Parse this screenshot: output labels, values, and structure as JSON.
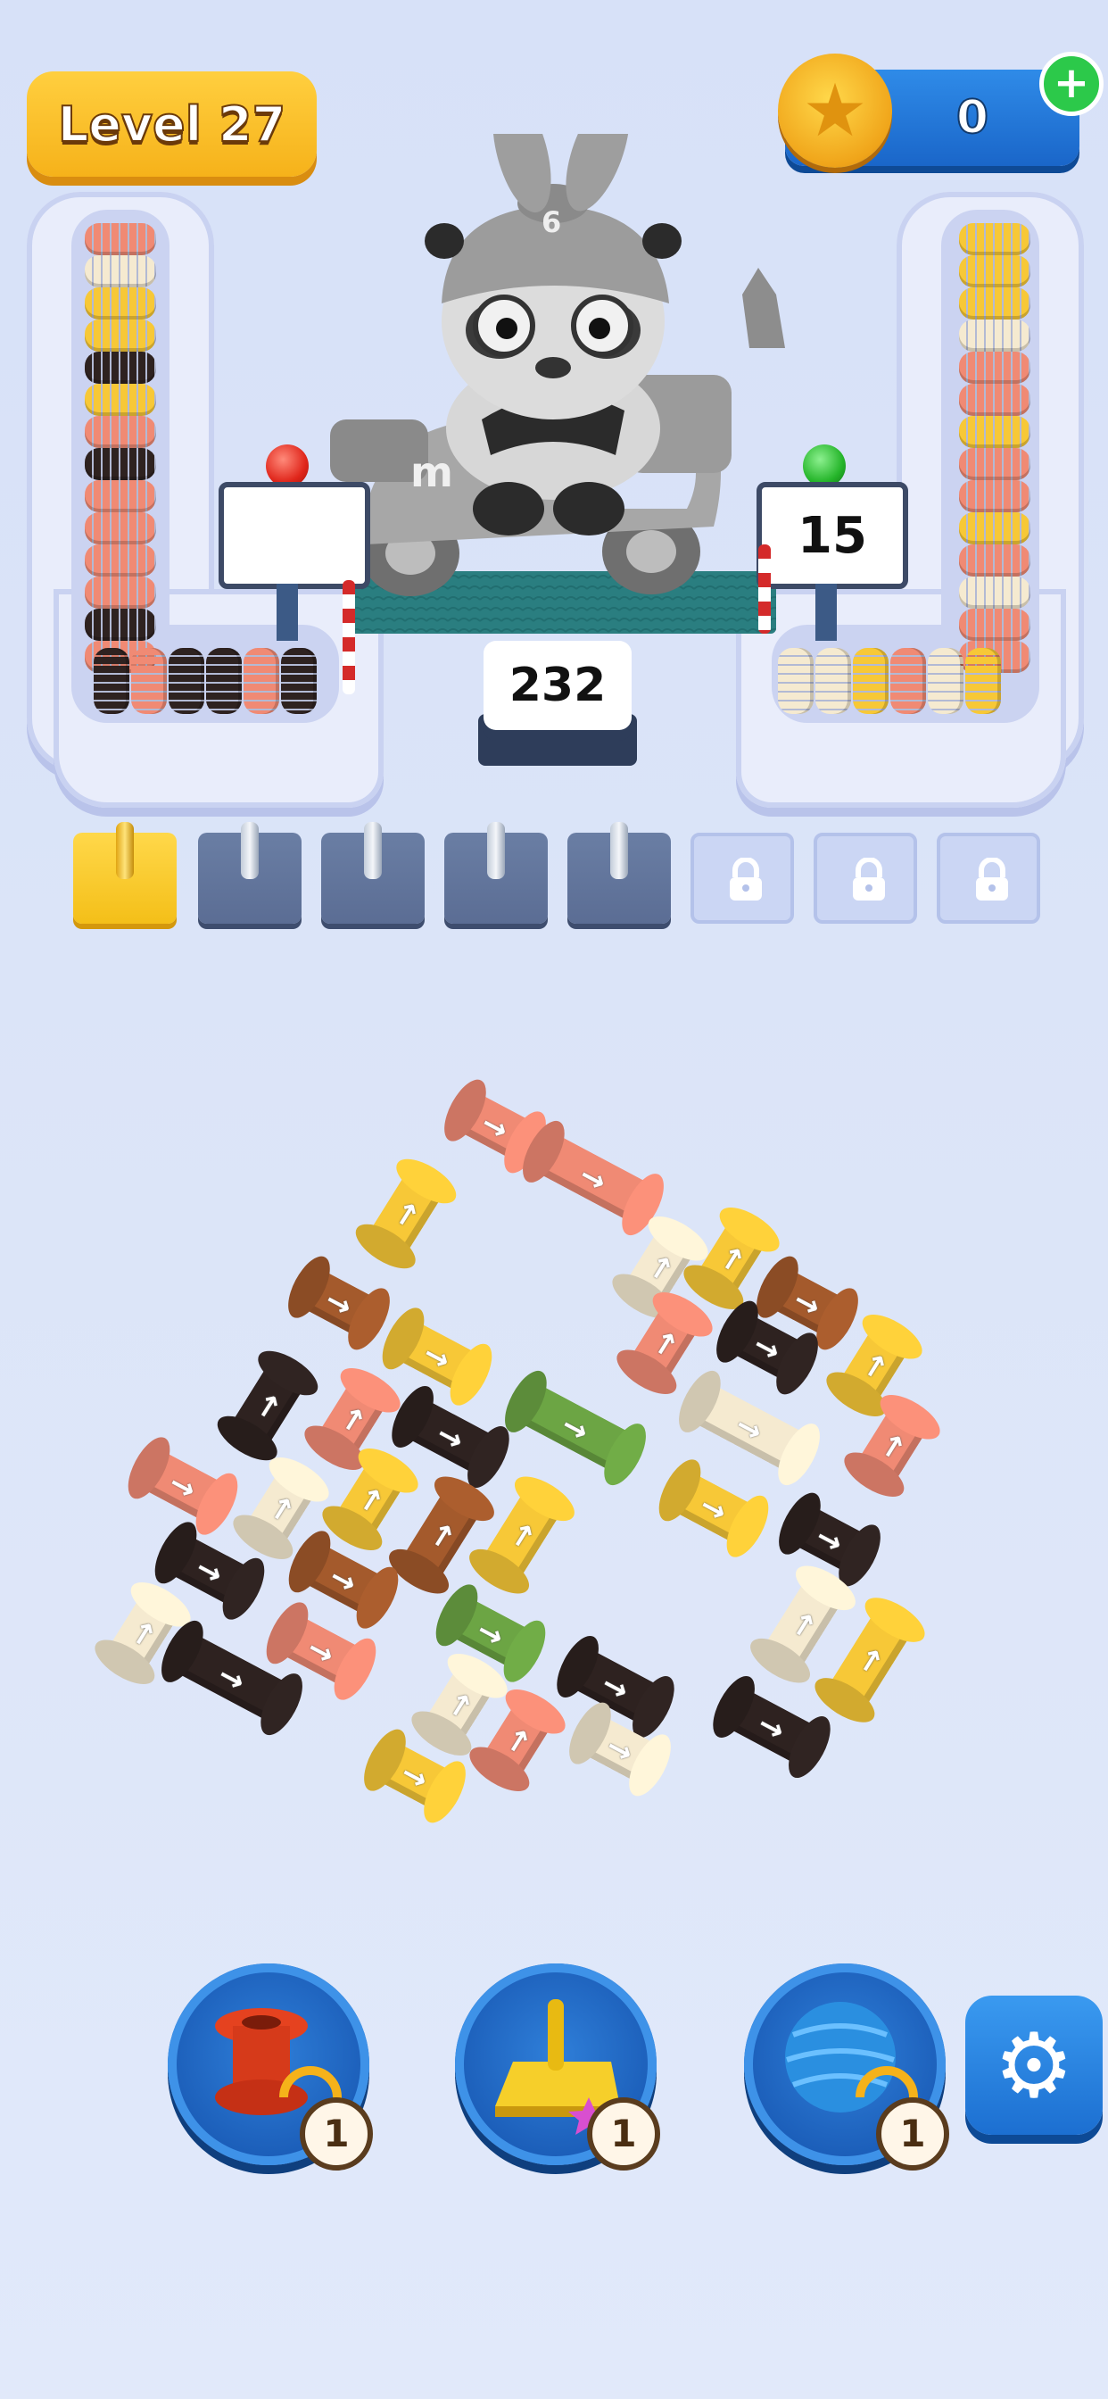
{
  "header": {
    "level_label": "Level 27",
    "coins": "0",
    "coin_icon": "star-coin-icon",
    "add_icon": "plus-icon"
  },
  "machine": {
    "left_sign_value": "",
    "right_sign_value": "15",
    "total_remaining": "232",
    "left_light_color": "#e0261b",
    "right_light_color": "#25b52a"
  },
  "slots": [
    {
      "state": "filled"
    },
    {
      "state": "empty"
    },
    {
      "state": "empty"
    },
    {
      "state": "empty"
    },
    {
      "state": "empty"
    },
    {
      "state": "locked"
    },
    {
      "state": "locked"
    },
    {
      "state": "locked"
    }
  ],
  "palette": {
    "salmon": "#f08a74",
    "yellow": "#f7c837",
    "cream": "#f5ead0",
    "black": "#2e2220",
    "brown": "#a45a2c",
    "green": "#6ca544"
  },
  "boosters": [
    {
      "name": "swap-spool",
      "icon": "spool-refresh-icon",
      "count": "1"
    },
    {
      "name": "extra-slot",
      "icon": "yellow-peg-star-icon",
      "count": "1"
    },
    {
      "name": "shuffle-yarn",
      "icon": "yarn-ball-refresh-icon",
      "count": "1"
    }
  ],
  "settings_icon": "gear-icon"
}
